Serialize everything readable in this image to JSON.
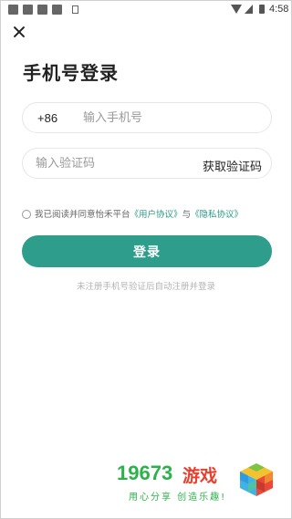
{
  "status_bar": {
    "time": "4:58"
  },
  "page": {
    "title": "手机号登录"
  },
  "phone": {
    "prefix": "+86",
    "placeholder": "输入手机号"
  },
  "code": {
    "placeholder": "输入验证码",
    "get_code_label": "获取验证码"
  },
  "agreement": {
    "prefix": "我已阅读并同意怡禾平台",
    "user_agreement": "《用户协议》",
    "connector": "与",
    "privacy_agreement": "《隐私协议》"
  },
  "login_button": "登录",
  "hint": "未注册手机号验证后自动注册并登录",
  "watermark": {
    "number": "19673",
    "word": "游戏",
    "slogan": "用心分享 创造乐趣!"
  },
  "colors": {
    "accent": "#2e9d8b",
    "link": "#2a9a86",
    "watermark_green": "#2db24b",
    "watermark_red": "#e8402f"
  }
}
